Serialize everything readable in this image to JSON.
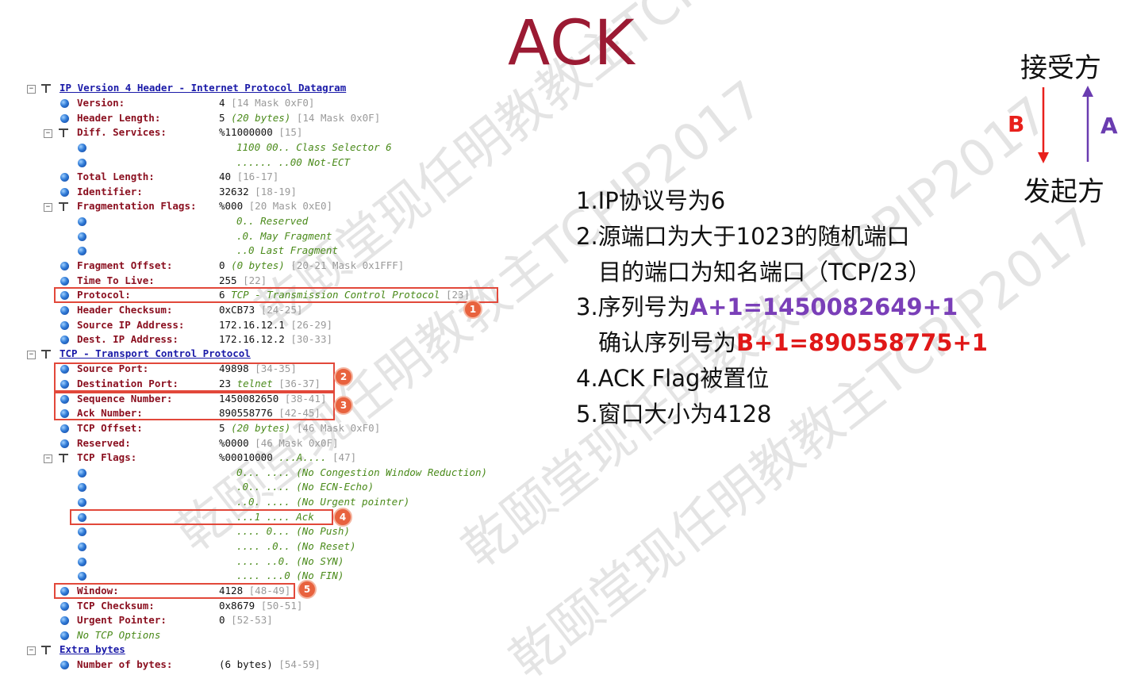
{
  "slide_title": "ACK",
  "watermark": "乾颐堂现任明教教主TCPIP2017",
  "ip_header": {
    "title": "IP Version 4 Header - Internet Protocol Datagram",
    "fields": {
      "version": {
        "label": "Version:",
        "value": "4",
        "extra": "[14 Mask 0xF0]"
      },
      "header_length": {
        "label": "Header Length:",
        "value": "5",
        "note": "(20 bytes)",
        "extra": "[14 Mask 0x0F]"
      },
      "diff_services": {
        "label": "Diff. Services:",
        "value": "%11000000",
        "extra": "[15]",
        "bits": [
          "1100 00.. Class Selector 6",
          "...... ..00 Not-ECT"
        ]
      },
      "total_length": {
        "label": "Total Length:",
        "value": "40",
        "extra": "[16-17]"
      },
      "identifier": {
        "label": "Identifier:",
        "value": "32632",
        "extra": "[18-19]"
      },
      "frag_flags": {
        "label": "Fragmentation Flags:",
        "value": "%000",
        "extra": "[20 Mask 0xE0]",
        "bits": [
          "0.. Reserved",
          ".0. May Fragment",
          "..0 Last Fragment"
        ]
      },
      "frag_offset": {
        "label": "Fragment Offset:",
        "value": "0",
        "note": "(0 bytes)",
        "extra": "[20-21 Mask 0x1FFF]"
      },
      "ttl": {
        "label": "Time To Live:",
        "value": "255",
        "extra": "[22]"
      },
      "protocol": {
        "label": "Protocol:",
        "value": "6",
        "note": "TCP - Transmission Control Protocol",
        "extra": "[23]"
      },
      "checksum": {
        "label": "Header Checksum:",
        "value": "0xCB73",
        "extra": "[24-25]"
      },
      "src_ip": {
        "label": "Source IP Address:",
        "value": "172.16.12.1",
        "extra": "[26-29]"
      },
      "dst_ip": {
        "label": "Dest. IP Address:",
        "value": "172.16.12.2",
        "extra": "[30-33]"
      }
    }
  },
  "tcp_header": {
    "title": "TCP - Transport Control Protocol",
    "fields": {
      "src_port": {
        "label": "Source Port:",
        "value": "49898",
        "extra": "[34-35]"
      },
      "dst_port": {
        "label": "Destination Port:",
        "value": "23",
        "note": "telnet",
        "extra": "[36-37]"
      },
      "seq": {
        "label": "Sequence Number:",
        "value": "1450082650",
        "extra": "[38-41]"
      },
      "ack": {
        "label": "Ack Number:",
        "value": "890558776",
        "extra": "[42-45]"
      },
      "offset": {
        "label": "TCP Offset:",
        "value": "5",
        "note": "(20 bytes)",
        "extra": "[46 Mask 0xF0]"
      },
      "reserved": {
        "label": "Reserved:",
        "value": "%0000",
        "extra": "[46 Mask 0x0F]"
      },
      "flags": {
        "label": "TCP Flags:",
        "value": "%00010000",
        "note": "...A....",
        "extra": "[47]",
        "bits": [
          "0... .... (No Congestion Window Reduction)",
          ".0.. .... (No ECN-Echo)",
          "..0. .... (No Urgent pointer)",
          "...1 .... Ack",
          ".... 0... (No Push)",
          ".... .0.. (No Reset)",
          ".... ..0. (No SYN)",
          ".... ...0 (No FIN)"
        ]
      },
      "window": {
        "label": "Window:",
        "value": "4128",
        "extra": "[48-49]"
      },
      "tcp_checksum": {
        "label": "TCP Checksum:",
        "value": "0x8679",
        "extra": "[50-51]"
      },
      "urgent": {
        "label": "Urgent Pointer:",
        "value": "0",
        "extra": "[52-53]"
      },
      "options": {
        "label": "No TCP Options"
      }
    }
  },
  "extra_bytes": {
    "title": "Extra bytes",
    "count": {
      "label": "Number of bytes:",
      "value": "(6 bytes)",
      "extra": "[54-59]"
    }
  },
  "markers": [
    "1",
    "2",
    "3",
    "4",
    "5"
  ],
  "notes": {
    "line1": "1.IP协议号为6",
    "line2": "2.源端口为大于1023的随机端口",
    "line2b": "目的端口为知名端口（TCP/23）",
    "line3_prefix": "3.序列号为",
    "line3_value": "A+1=1450082649+1",
    "line3b_prefix": "确认序列号为",
    "line3b_value": "B+1=890558775+1",
    "line4": "4.ACK Flag被置位",
    "line5": "5.窗口大小为4128"
  },
  "diagram": {
    "receiver": "接受方",
    "initiator": "发起方",
    "b_label": "B",
    "a_label": "A",
    "b_color": "#e8201c",
    "a_color": "#6a3cb0"
  },
  "colors": {
    "title": "#9b1a33",
    "field_label": "#8b1020",
    "header_link": "#1a1aa8",
    "highlight": "#e2483a"
  }
}
